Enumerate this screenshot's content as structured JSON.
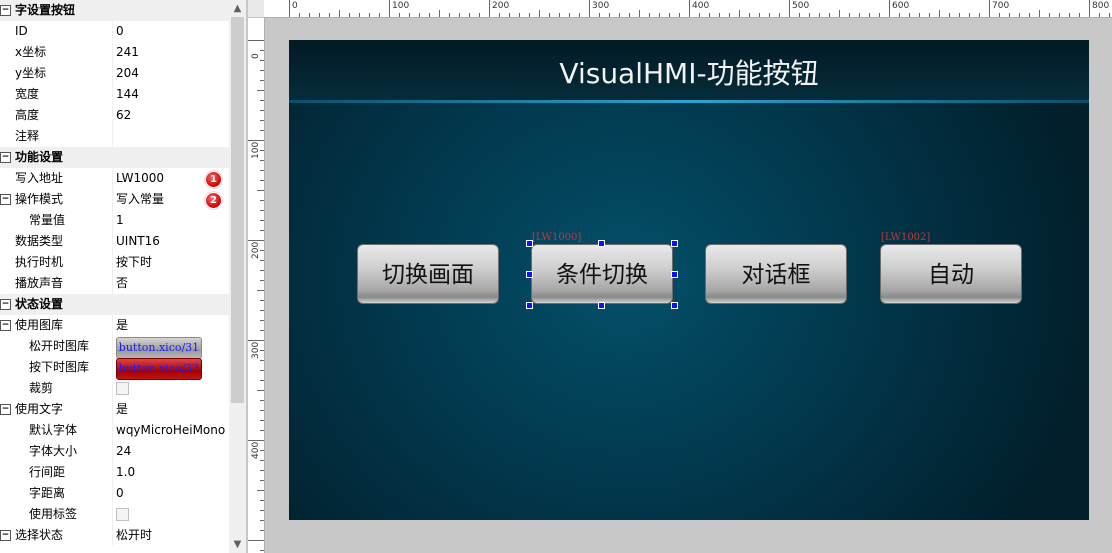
{
  "properties": {
    "rows": [
      {
        "type": "cat",
        "label": "字设置按钮"
      },
      {
        "type": "prop",
        "label": "ID",
        "value": "0"
      },
      {
        "type": "prop",
        "label": "x坐标",
        "value": "241"
      },
      {
        "type": "prop",
        "label": "y坐标",
        "value": "204"
      },
      {
        "type": "prop",
        "label": "宽度",
        "value": "144"
      },
      {
        "type": "prop",
        "label": "高度",
        "value": "62"
      },
      {
        "type": "prop",
        "label": "注释",
        "value": ""
      },
      {
        "type": "cat",
        "label": "功能设置"
      },
      {
        "type": "prop",
        "label": "写入地址",
        "value": "LW1000",
        "badge": "1"
      },
      {
        "type": "group",
        "label": "操作模式",
        "value": "写入常量",
        "badge": "2"
      },
      {
        "type": "sub",
        "label": "常量值",
        "value": "1"
      },
      {
        "type": "prop",
        "label": "数据类型",
        "value": "UINT16"
      },
      {
        "type": "prop",
        "label": "执行时机",
        "value": "按下时"
      },
      {
        "type": "prop",
        "label": "播放声音",
        "value": "否"
      },
      {
        "type": "cat",
        "label": "状态设置"
      },
      {
        "type": "group",
        "label": "使用图库",
        "value": "是"
      },
      {
        "type": "sub",
        "label": "松开时图库",
        "image": "button.xico/31",
        "image_style": "gray"
      },
      {
        "type": "sub",
        "label": "按下时图库",
        "image": "button.xico/33",
        "image_style": "red"
      },
      {
        "type": "sub",
        "label": "裁剪",
        "checkbox": true
      },
      {
        "type": "group",
        "label": "使用文字",
        "value": "是"
      },
      {
        "type": "sub",
        "label": "默认字体",
        "value": "wqyMicroHeiMono"
      },
      {
        "type": "sub",
        "label": "字体大小",
        "value": "24"
      },
      {
        "type": "sub",
        "label": "行间距",
        "value": "1.0"
      },
      {
        "type": "sub",
        "label": "字距离",
        "value": "0"
      },
      {
        "type": "sub",
        "label": "使用标签",
        "checkbox": true
      },
      {
        "type": "group",
        "label": "选择状态",
        "value": "松开时"
      }
    ]
  },
  "ruler": {
    "h_labels": [
      "0",
      "100",
      "200",
      "300",
      "400",
      "500",
      "600",
      "700",
      "800"
    ],
    "v_labels": [
      "0",
      "100",
      "200",
      "300",
      "400"
    ]
  },
  "hmi": {
    "title": "VisualHMI-功能按钮",
    "buttons": [
      {
        "label": "切换画面",
        "address": ""
      },
      {
        "label": "条件切换",
        "address": "[LW1000]"
      },
      {
        "label": "对话框",
        "address": ""
      },
      {
        "label": "自动",
        "address": "[LW1002]"
      }
    ]
  },
  "colors": {
    "badge": "#cc0000",
    "selection_handle": "#1010ff",
    "address_text": "#c23838"
  },
  "icons": {
    "expand": "minus-box-icon",
    "scroll_up": "chevron-up-icon",
    "scroll_down": "chevron-down-icon"
  }
}
